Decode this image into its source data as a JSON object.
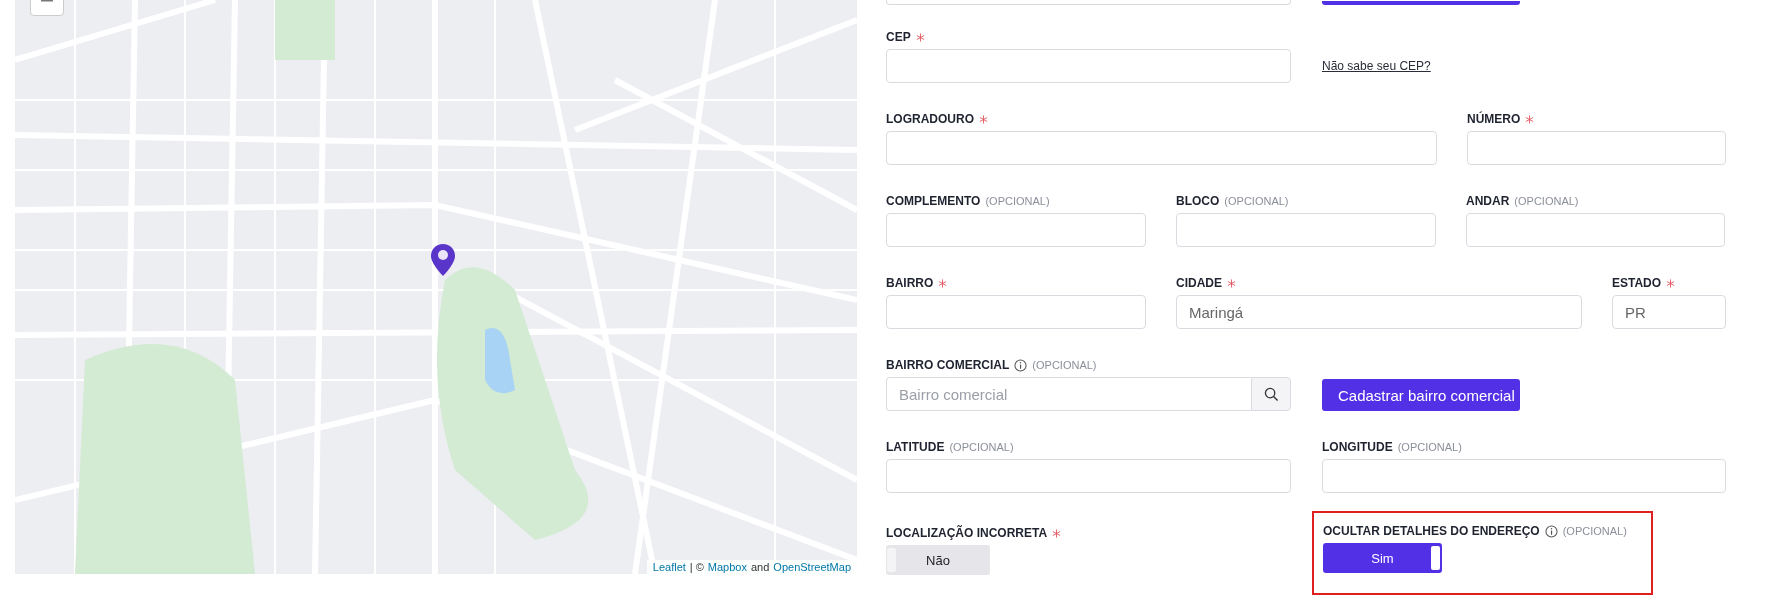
{
  "map": {
    "attribution": [
      {
        "kind": "link",
        "text": "Leaflet"
      },
      {
        "kind": "text",
        "text": "| ©"
      },
      {
        "kind": "link",
        "text": "Mapbox"
      },
      {
        "kind": "text",
        "text": "and"
      },
      {
        "kind": "link",
        "text": "OpenStreetMap"
      }
    ]
  },
  "form": {
    "rows": [
      {
        "fields": [
          {
            "kind": "stub-input"
          },
          {
            "kind": "stub-button"
          }
        ]
      },
      {
        "fields": [
          {
            "kind": "input",
            "label": "CEP",
            "required": true
          },
          {
            "kind": "link",
            "text": "Não sabe seu CEP?"
          }
        ]
      },
      {
        "fields": [
          {
            "kind": "input",
            "label": "LOGRADOURO",
            "required": true
          },
          {
            "kind": "input",
            "label": "NÚMERO",
            "required": true
          }
        ]
      },
      {
        "fields": [
          {
            "kind": "input",
            "label": "COMPLEMENTO",
            "optional": "(OPCIONAL)"
          },
          {
            "kind": "input",
            "label": "BLOCO",
            "optional": "(OPCIONAL)"
          },
          {
            "kind": "input",
            "label": "ANDAR",
            "optional": "(OPCIONAL)"
          }
        ]
      },
      {
        "fields": [
          {
            "kind": "input",
            "label": "BAIRRO",
            "required": true
          },
          {
            "kind": "input",
            "label": "CIDADE",
            "required": true,
            "value": "Maringá"
          },
          {
            "kind": "input",
            "label": "ESTADO",
            "required": true,
            "value": "PR"
          }
        ]
      },
      {
        "fields": [
          {
            "kind": "search",
            "label": "BAIRRO COMERCIAL",
            "info": true,
            "optional": "(OPCIONAL)",
            "placeholder": "Bairro comercial"
          },
          {
            "kind": "button",
            "text": "Cadastrar bairro comercial"
          }
        ]
      },
      {
        "fields": [
          {
            "kind": "input",
            "label": "LATITUDE",
            "optional": "(OPCIONAL)"
          },
          {
            "kind": "input",
            "label": "LONGITUDE",
            "optional": "(OPCIONAL)"
          }
        ]
      },
      {
        "fields": [
          {
            "kind": "toggle",
            "label": "LOCALIZAÇÃO INCORRETA",
            "required": true,
            "text": "Não",
            "on": false,
            "highlighted": false
          },
          {
            "kind": "toggle",
            "label": "OCULTAR DETALHES DO ENDEREÇO",
            "info": true,
            "optional": "(OPCIONAL)",
            "text": "Sim",
            "on": true,
            "highlighted": true
          }
        ]
      }
    ]
  }
}
